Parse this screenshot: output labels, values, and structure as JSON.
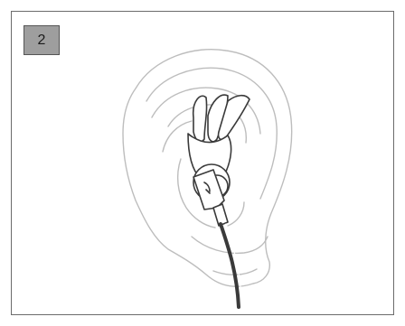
{
  "step": {
    "number": "2"
  },
  "colors": {
    "ear_outline": "#bdbdbd",
    "earphone_outline": "#3a3a3a",
    "frame": "#6b6b6b",
    "badge_fill": "#9e9e9e"
  },
  "illustration": {
    "subject_icon": "ear-with-sport-earphone-icon"
  }
}
